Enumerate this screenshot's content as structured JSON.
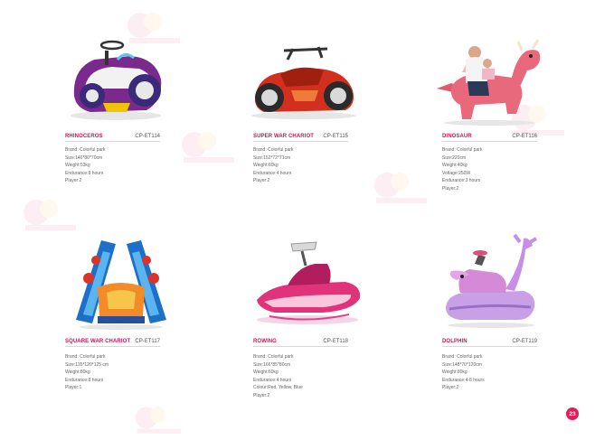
{
  "products": [
    {
      "name": "RHINOCEROS",
      "code": "CP-ET114",
      "specs": [
        "Brand: Colorful park",
        "Size:140*80*70cm",
        "Weight:53kg",
        "Endurance:8 hours",
        "Player:2"
      ],
      "image_icon": "rhinoceros-ride-icon"
    },
    {
      "name": "SUPER WAR CHARIOT",
      "code": "CP-ET115",
      "specs": [
        "Brand: Colorful park",
        "Size:152*72*71cm",
        "Weight:60kg",
        "Endurance:4 hours",
        "Player:2"
      ],
      "image_icon": "war-chariot-ride-icon"
    },
    {
      "name": "DINOSAUR",
      "code": "CP-ET116",
      "specs": [
        "Brand: Colorful park",
        "Size:220cm",
        "Weight:40kg",
        "Voltage:250W",
        "Endurance:3 hours",
        "Player:2"
      ],
      "image_icon": "dinosaur-ride-icon"
    },
    {
      "name": "SQUARE WAR CHARIOT",
      "code": "CP-ET117",
      "specs": [
        "Brand: Colorful park",
        "Size:135*120*125 cm",
        "Weight:80kg",
        "Endurance:8 hours",
        "Player:1"
      ],
      "image_icon": "square-chariot-ride-icon"
    },
    {
      "name": "ROWING",
      "code": "CP-ET118",
      "specs": [
        "Brand: Colorful park",
        "Size:166*85*80cm",
        "Weight:60kg",
        "Endurance:4 hours",
        "Colour:Red, Yellow, Blue",
        "Player:2"
      ],
      "image_icon": "jet-ski-ride-icon"
    },
    {
      "name": "DOLPHIN",
      "code": "CP-ET119",
      "specs": [
        "Brand: Colorful park",
        "Size:148*70*120cm",
        "Weight:80kg",
        "Endurance:4-8 hours",
        "Player:2"
      ],
      "image_icon": "dolphin-ride-icon"
    }
  ],
  "page_number": "23",
  "colors": {
    "accent": "#c8145a",
    "page_badge": "#e11d5a",
    "text": "#666666"
  },
  "watermark_icon": "colorful-park-logo-icon"
}
